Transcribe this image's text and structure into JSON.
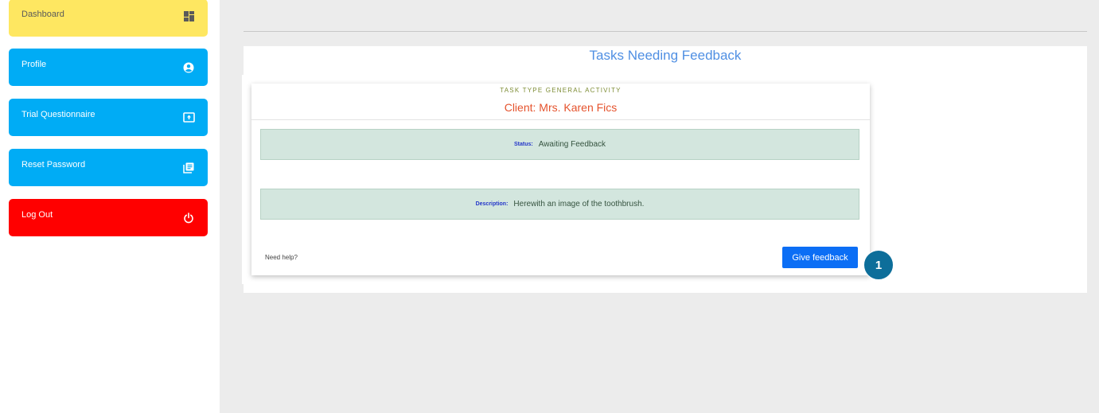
{
  "sidebar": {
    "items": [
      {
        "label": "Dashboard",
        "icon": "dashboard-icon",
        "color": "#fee761"
      },
      {
        "label": "Profile",
        "icon": "account-circle-icon",
        "color": "#00acf5"
      },
      {
        "label": "Trial Questionnaire",
        "icon": "upload-box-icon",
        "color": "#00acf5"
      },
      {
        "label": "Reset Password",
        "icon": "library-books-icon",
        "color": "#00acf5"
      },
      {
        "label": "Log Out",
        "icon": "power-icon",
        "color": "#ff0000"
      }
    ]
  },
  "main": {
    "title": "Tasks Needing Feedback",
    "card": {
      "task_type": "TASK TYPE GENERAL ACTIVITY",
      "client": "Client: Mrs. Karen Fics",
      "status_label": "Status:",
      "status_value": "Awaiting Feedback",
      "description_label": "Description:",
      "description_value": "Herewith an image of the toothbrush.",
      "help_text": "Need help?",
      "feedback_button": "Give feedback"
    },
    "step_badge": "1"
  },
  "colors": {
    "accent": "#0b6ef5",
    "title": "#4f8fe3",
    "client": "#e5532d",
    "status_box": "#d3e6de"
  }
}
